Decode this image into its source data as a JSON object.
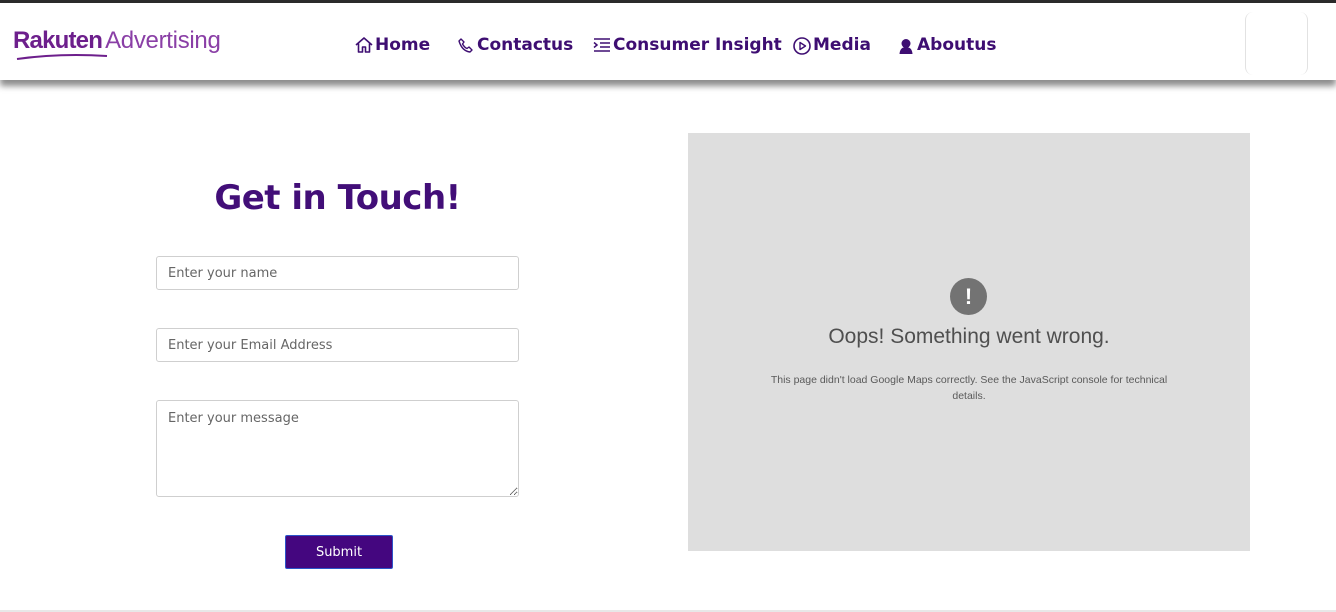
{
  "header": {
    "logo_word1": "Rakuten",
    "logo_word2": "Advertising",
    "nav": [
      {
        "label": "Home",
        "icon": "home-icon"
      },
      {
        "label": "Contactus",
        "icon": "phone-icon"
      },
      {
        "label": "Consumer Insight",
        "icon": "list-indent-icon"
      },
      {
        "label": "Media",
        "icon": "play-circle-icon"
      },
      {
        "label": "Aboutus",
        "icon": "person-icon"
      }
    ]
  },
  "contact_form": {
    "title": "Get in Touch!",
    "name_placeholder": "Enter your name",
    "email_placeholder": "Enter your Email Address",
    "message_placeholder": "Enter your message",
    "submit_label": "Submit"
  },
  "map": {
    "icon": "!",
    "error_title": "Oops! Something went wrong.",
    "error_detail": "This page didn't load Google Maps correctly. See the JavaScript console for technical details."
  },
  "colors": {
    "brand": "#6d1f8c",
    "nav_text": "#3e0e72",
    "title": "#420e78",
    "button": "#44067f",
    "map_bg": "#dedede"
  }
}
